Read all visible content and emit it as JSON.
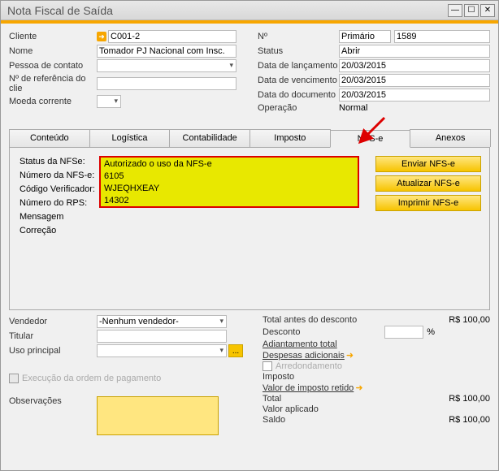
{
  "window": {
    "title": "Nota Fiscal de Saída"
  },
  "header": {
    "left": {
      "cliente_lbl": "Cliente",
      "cliente_val": "C001-2",
      "nome_lbl": "Nome",
      "nome_val": "Tomador PJ Nacional com Insc.",
      "contato_lbl": "Pessoa de contato",
      "refcli_lbl": "Nº de referência do clie",
      "moeda_lbl": "Moeda corrente"
    },
    "right": {
      "num_lbl": "Nº",
      "num_type": "Primário",
      "num_val": "1589",
      "status_lbl": "Status",
      "status_val": "Abrir",
      "lanc_lbl": "Data de lançamento",
      "lanc_val": "20/03/2015",
      "venc_lbl": "Data de vencimento",
      "venc_val": "20/03/2015",
      "doc_lbl": "Data do documento",
      "doc_val": "20/03/2015",
      "oper_lbl": "Operação",
      "oper_val": "Normal"
    }
  },
  "tabs": {
    "conteudo": "Conteúdo",
    "logistica": "Logística",
    "contabilidade": "Contabilidade",
    "imposto": "Imposto",
    "nfse": "NFS-e",
    "anexos": "Anexos"
  },
  "nfse": {
    "status_lbl": "Status da NFSe:",
    "status_val": "Autorizado o uso da NFS-e",
    "numero_lbl": "Número da NFS-e:",
    "numero_val": "6105",
    "codver_lbl": "Código Verificador:",
    "codver_val": "WJEQHXEAY",
    "rps_lbl": "Número do RPS:",
    "rps_val": "14302",
    "mensagem_lbl": "Mensagem",
    "correcao_lbl": "Correção",
    "btn_enviar": "Enviar NFS-e",
    "btn_atualizar": "Atualizar NFS-e",
    "btn_imprimir": "Imprimir NFS-e"
  },
  "bottom": {
    "vendedor_lbl": "Vendedor",
    "vendedor_val": "-Nenhum vendedor-",
    "titular_lbl": "Titular",
    "uso_lbl": "Uso principal",
    "exec_lbl": "Execução da ordem de pagamento",
    "obs_lbl": "Observações"
  },
  "totals": {
    "antes_lbl": "Total antes do desconto",
    "antes_val": "R$ 100,00",
    "desc_lbl": "Desconto",
    "desc_pct": "%",
    "adiant_lbl": "Adiantamento total",
    "desp_lbl": "Despesas adicionais",
    "arred_lbl": "Arredondamento",
    "imposto_lbl": "Imposto",
    "retido_lbl": "Valor de imposto retido",
    "total_lbl": "Total",
    "total_val": "R$ 100,00",
    "aplicado_lbl": "Valor aplicado",
    "saldo_lbl": "Saldo",
    "saldo_val": "R$ 100,00"
  }
}
